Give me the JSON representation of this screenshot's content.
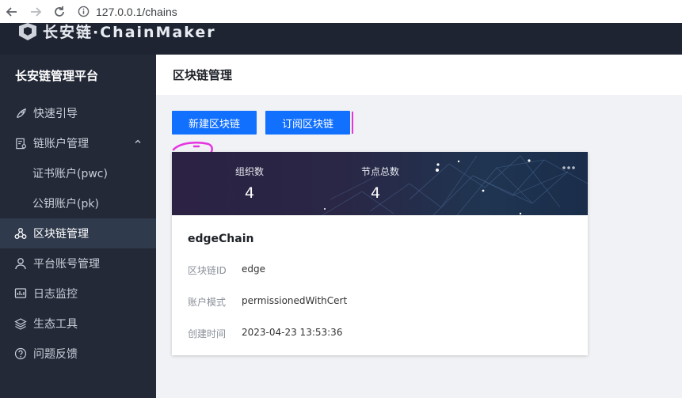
{
  "browser": {
    "url": "127.0.0.1/chains"
  },
  "header": {
    "logo_text": "长安链·ChainMaker"
  },
  "sidebar": {
    "title": "长安链管理平台",
    "items": [
      {
        "label": "快速引导",
        "icon": "rocket-icon"
      },
      {
        "label": "链账户管理",
        "icon": "account-doc-icon",
        "expanded": true
      },
      {
        "label": "证书账户(pwc)",
        "sub": true
      },
      {
        "label": "公钥账户(pk)",
        "sub": true
      },
      {
        "label": "区块链管理",
        "icon": "blockchain-icon",
        "active": true
      },
      {
        "label": "平台账号管理",
        "icon": "user-icon"
      },
      {
        "label": "日志监控",
        "icon": "monitor-icon"
      },
      {
        "label": "生态工具",
        "icon": "layers-icon"
      },
      {
        "label": "问题反馈",
        "icon": "question-icon"
      }
    ]
  },
  "main": {
    "page_title": "区块链管理",
    "buttons": {
      "new_chain": "新建区块链",
      "subscribe_chain": "订阅区块链"
    },
    "card": {
      "stats": [
        {
          "label": "组织数",
          "value": "4"
        },
        {
          "label": "节点总数",
          "value": "4"
        }
      ],
      "chain_name": "edgeChain",
      "fields": [
        {
          "key": "区块链ID",
          "value": "edge"
        },
        {
          "key": "账户模式",
          "value": "permissionedWithCert"
        },
        {
          "key": "创建时间",
          "value": "2023-04-23 13:53:36"
        }
      ]
    }
  },
  "colors": {
    "primary": "#1270ff",
    "sidebar_bg": "#232937",
    "annotation": "#e535e0"
  }
}
